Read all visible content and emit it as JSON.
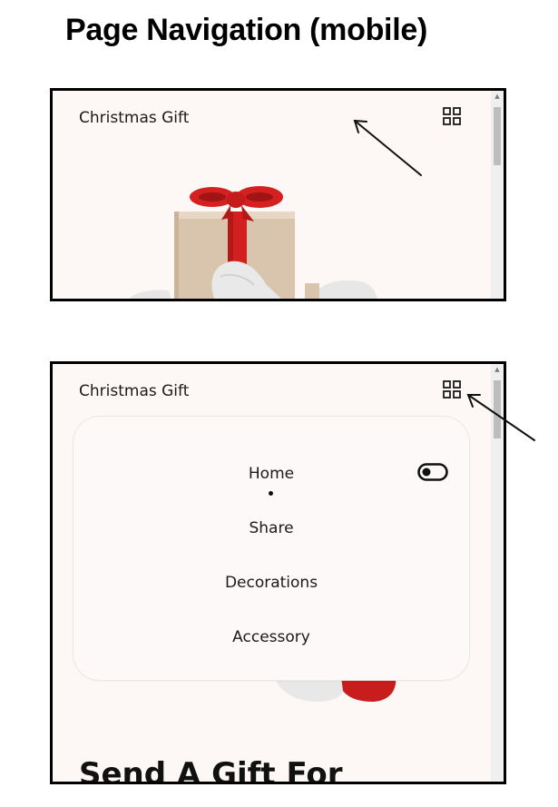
{
  "page_title": "Page Navigation (mobile)",
  "brand": "Christmas Gift",
  "icons": {
    "menu": "grid-menu-icon",
    "theme": "toggle-icon"
  },
  "menu": {
    "items": [
      {
        "label": "Home",
        "active": true
      },
      {
        "label": "Share",
        "active": false
      },
      {
        "label": "Decorations",
        "active": false
      },
      {
        "label": "Accessory",
        "active": false
      }
    ]
  },
  "hero": {
    "headline": "Send A Gift For"
  },
  "colors": {
    "background": "#fdf8f6",
    "frame_border": "#000000",
    "ribbon": "#d42020",
    "box": "#d8c3ab",
    "glove": "#e8e8e8"
  }
}
